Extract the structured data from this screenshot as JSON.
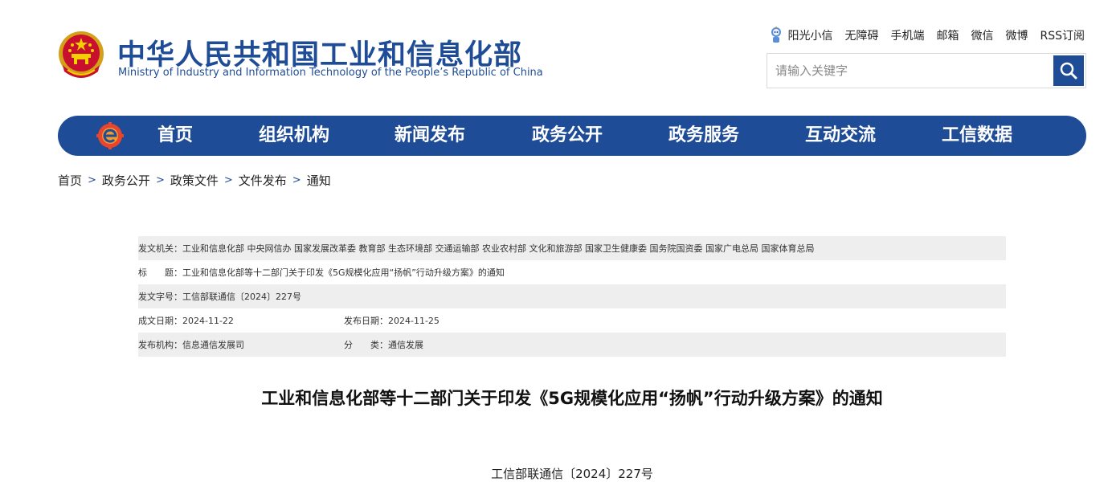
{
  "header": {
    "title": "中华人民共和国工业和信息化部",
    "subtitle": "Ministry of Industry and Information Technology of the People’s Republic of China",
    "emblem_icon": "national-emblem-icon"
  },
  "top_links": {
    "sunshine": "阳光小信",
    "accessibility": "无障碍",
    "mobile": "手机端",
    "mail": "邮箱",
    "wechat": "微信",
    "weibo": "微博",
    "rss": "RSS订阅"
  },
  "search": {
    "placeholder": "请输入关键字",
    "icon": "search-icon"
  },
  "nav": {
    "items": [
      "首页",
      "组织机构",
      "新闻发布",
      "政务公开",
      "政务服务",
      "互动交流",
      "工信数据"
    ]
  },
  "breadcrumb": [
    "首页",
    "政务公开",
    "政策文件",
    "文件发布",
    "通知"
  ],
  "info": {
    "issuer_label": "发文机关：",
    "issuer_value": "工业和信息化部 中央网信办 国家发展改革委 教育部 生态环境部 交通运输部 农业农村部 文化和旅游部 国家卫生健康委 国务院国资委 国家广电总局 国家体育总局",
    "title_label": "标　　题：",
    "title_value": "工业和信息化部等十二部门关于印发《5G规模化应用“扬帆”行动升级方案》的通知",
    "docno_label": "发文字号：",
    "docno_value": "工信部联通信〔2024〕227号",
    "created_label": "成文日期：",
    "created_value": "2024-11-22",
    "published_label": "发布日期：",
    "published_value": "2024-11-25",
    "org_label": "发布机构：",
    "org_value": "信息通信发展司",
    "category_label": "分　　类：",
    "category_value": "通信发展"
  },
  "document": {
    "title": "工业和信息化部等十二部门关于印发《5G规模化应用“扬帆”行动升级方案》的通知",
    "number": "工信部联通信〔2024〕227号"
  },
  "colors": {
    "brand_blue": "#1f4c97",
    "shade_gray": "#eeeeee"
  }
}
